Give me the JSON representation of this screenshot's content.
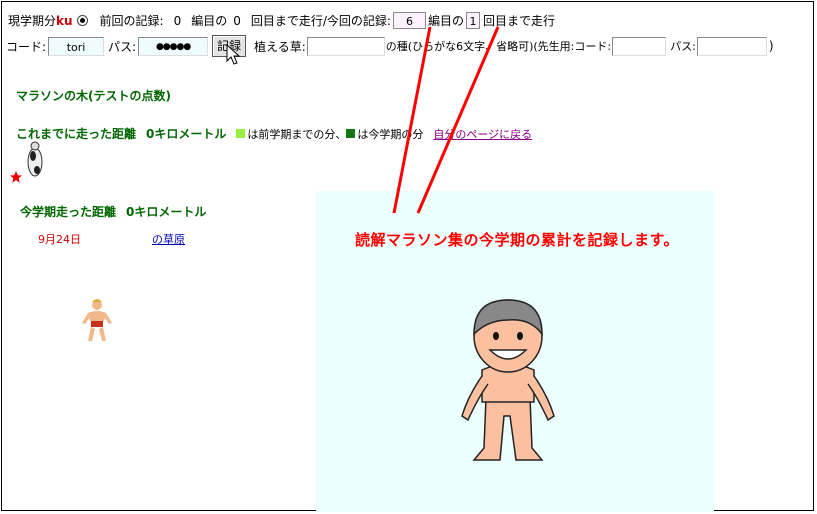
{
  "header": {
    "term_label": "現学期分",
    "term_code": "ku",
    "prev_label": "前回の記録:",
    "prev_count": "0",
    "volume_label": "編目の",
    "prev_round": "0",
    "prev_suffix": "回目まで走行/今回の記録:",
    "current_volume": "6",
    "volume_label2": "編目の",
    "current_round": "1",
    "run_suffix": "回目まで走行"
  },
  "login": {
    "code_label": "コード:",
    "code_value": "tori",
    "pass_label": "パス:",
    "pass_value": "●●●●●",
    "save_button": "記録",
    "grass_label": "植える草:",
    "grass_note": "の種(ひらがな6文字、省略可)(先生用:コード:",
    "teacher_pass_label": "パス:",
    "close_paren": ")"
  },
  "tree_title": "マラソンの木(テストの点数)",
  "distance": {
    "label": "これまでに走った距離",
    "value": "0キロメートル",
    "prev_term_note": "は前学期までの分、",
    "this_term_note": "は今学期の分",
    "back_link": "自分のページに戻る",
    "prev_color": "#99ee44",
    "this_color": "#117711"
  },
  "term_distance": {
    "label": "今学期走った距離",
    "value": "0キロメートル"
  },
  "records": [
    {
      "date": "9月24日",
      "meadow": "の草原"
    }
  ],
  "annotation": "読解マラソン集の今学期の累計を記録します。",
  "icons": {
    "star": "star-icon",
    "cow": "cow-icon",
    "runner": "runner-icon",
    "cursor": "mouse-cursor-icon",
    "character": "boy-character-icon"
  }
}
